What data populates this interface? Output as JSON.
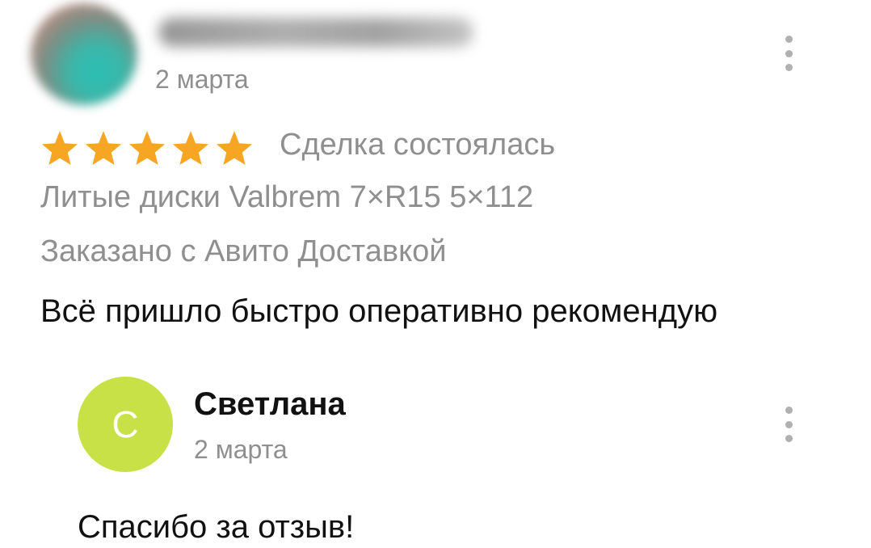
{
  "review": {
    "date": "2 марта",
    "rating": 5,
    "rating_max": 5,
    "deal_status": "Сделка состоялась",
    "item": "Литые диски Valbrem 7×R15 5×112",
    "delivery": "Заказано с Авито Доставкой",
    "text": "Всё пришло быстро оперативно рекомендую",
    "menu_icon": "more-vertical-icon"
  },
  "reply": {
    "avatar_letter": "С",
    "avatar_color": "#c8e146",
    "author": "Светлана",
    "date": "2 марта",
    "text": "Спасибо за отзыв!",
    "menu_icon": "more-vertical-icon"
  },
  "colors": {
    "star": "#f6a623",
    "secondary_text": "#8f8f8f",
    "primary_text": "#111111"
  }
}
